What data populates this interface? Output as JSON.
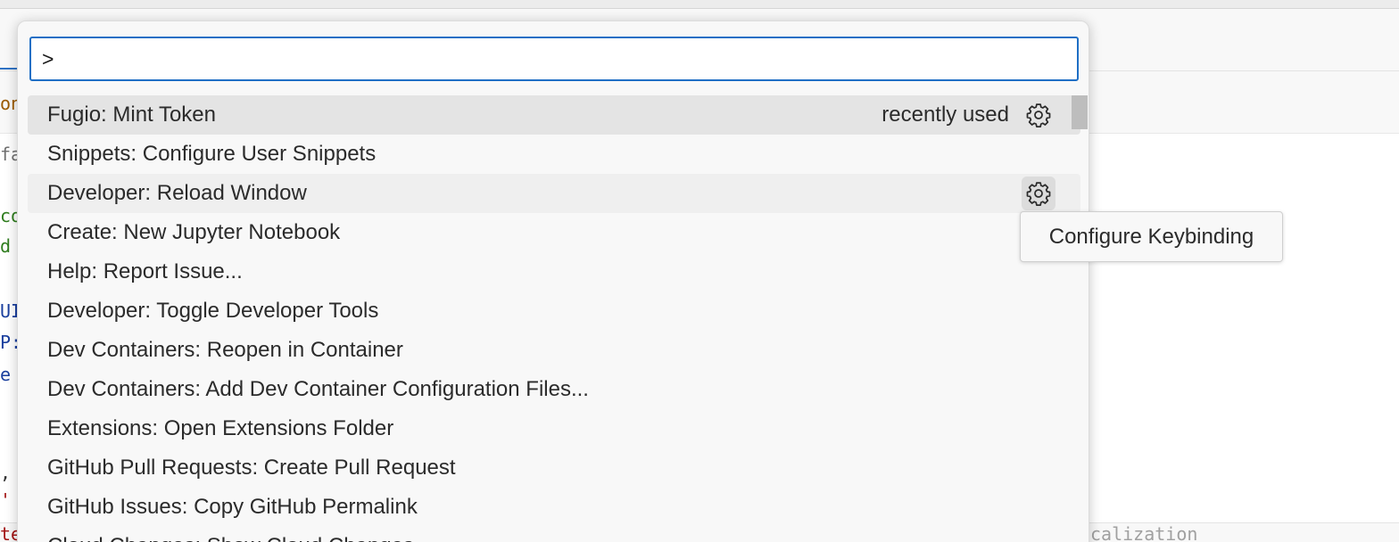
{
  "palette": {
    "input_value": ">",
    "items": [
      {
        "label": "Fugio: Mint Token",
        "tag": "recently used"
      },
      {
        "label": "Snippets: Configure User Snippets"
      },
      {
        "label": "Developer: Reload Window"
      },
      {
        "label": "Create: New Jupyter Notebook"
      },
      {
        "label": "Help: Report Issue..."
      },
      {
        "label": "Developer: Toggle Developer Tools"
      },
      {
        "label": "Dev Containers: Reopen in Container"
      },
      {
        "label": "Dev Containers: Add Dev Container Configuration Files..."
      },
      {
        "label": "Extensions: Open Extensions Folder"
      },
      {
        "label": "GitHub Pull Requests: Create Pull Request"
      },
      {
        "label": "GitHub Issues: Copy GitHub Permalink"
      },
      {
        "label": "Cloud Changes: Show Cloud Changes"
      }
    ],
    "gear_icon": "gear-icon"
  },
  "tooltip": {
    "text": "Configure Keybinding"
  },
  "background_editor": {
    "code_fragments": [
      "on",
      "fa",
      "co",
      "d",
      "UI",
      "P:",
      "e",
      ",",
      "'",
      "te"
    ],
    "status_right": "calization",
    "colors": {
      "keyword_orange": "#9b5a00",
      "comment_gray": "#707070",
      "string_green": "#2f7d1e",
      "type_blue": "#1a3f9e",
      "error_red": "#a31515",
      "focus_border": "#1f6fc5"
    }
  }
}
